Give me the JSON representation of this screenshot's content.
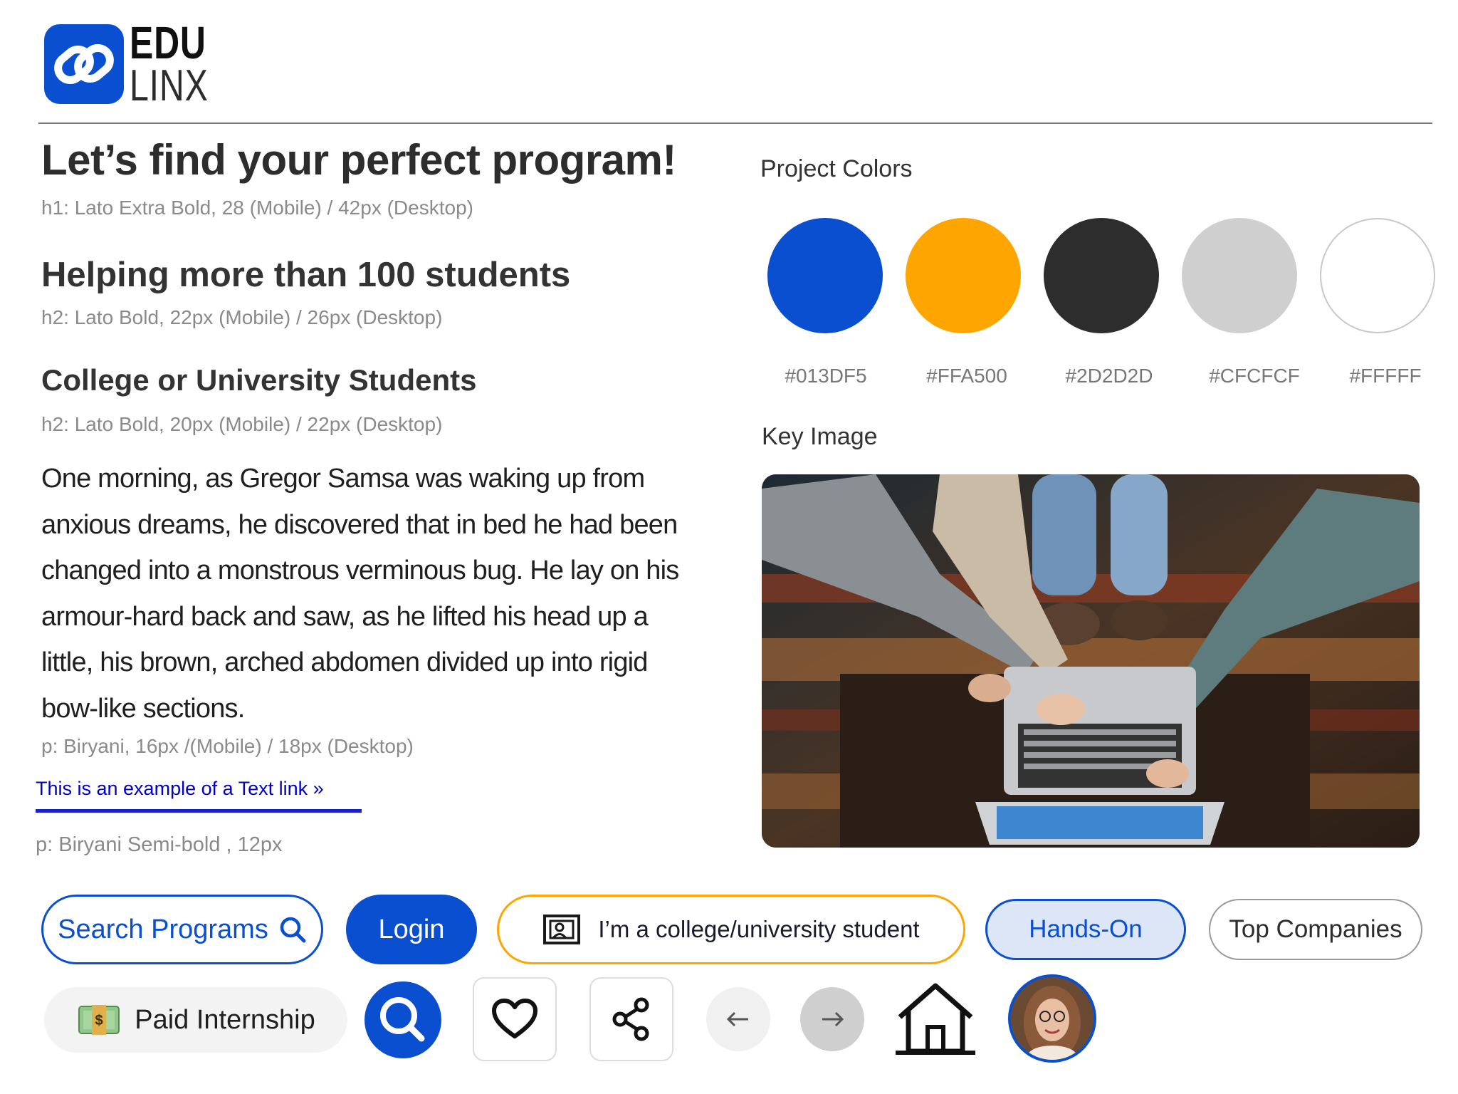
{
  "logo": {
    "line1": "EDU",
    "line2": "LINX"
  },
  "typography": {
    "h1": "Let’s find your perfect program!",
    "h1_note": "h1: Lato  Extra Bold, 28 (Mobile) /  42px (Desktop)",
    "h2": "Helping more than 100 students",
    "h2_note": "h2: Lato Bold, 22px (Mobile) / 26px (Desktop)",
    "h3": "College or University Students",
    "h3_note": "h2: Lato Bold, 20px (Mobile) / 22px (Desktop)",
    "paragraph": "One morning, as Gregor Samsa was waking up from anxious dreams, he discovered that in bed he had been changed into a monstrous verminous bug. He lay on his armour-hard back and saw, as he lifted his head up a little, his brown, arched abdomen divided up into rigid bow-like sections.",
    "paragraph_note": "p: Biryani, 16px /(Mobile) / 18px (Desktop)",
    "text_link": "This is an example of a Text link »",
    "text_link_note": "p: Biryani Semi-bold , 12px"
  },
  "colors": {
    "title": "Project Colors",
    "swatches": [
      {
        "hex": "#013DF5",
        "label": "#013DF5",
        "display": "#0A4FD0"
      },
      {
        "hex": "#FFA500",
        "label": "#FFA500",
        "display": "#FFA500"
      },
      {
        "hex": "#2D2D2D",
        "label": "#2D2D2D",
        "display": "#2D2D2D"
      },
      {
        "hex": "#CFCFCF",
        "label": "#CFCFCF",
        "display": "#CFCFCF"
      },
      {
        "hex": "#FFFFF",
        "label": "#FFFFF",
        "display": "#FFFFFF"
      }
    ]
  },
  "key_image": {
    "title": "Key Image"
  },
  "buttons": {
    "search_programs": "Search Programs",
    "login": "Login",
    "student": "I’m a college/university student",
    "hands_on": "Hands-On",
    "top_companies": "Top Companies",
    "paid_internship": "Paid Internship",
    "icons": [
      "search-icon",
      "heart-icon",
      "share-icon",
      "arrow-left-icon",
      "arrow-right-icon",
      "home-icon",
      "avatar"
    ]
  },
  "accent": {
    "primary": "#0A4FD0",
    "secondary": "#FFA500",
    "link": "#0000C8"
  }
}
